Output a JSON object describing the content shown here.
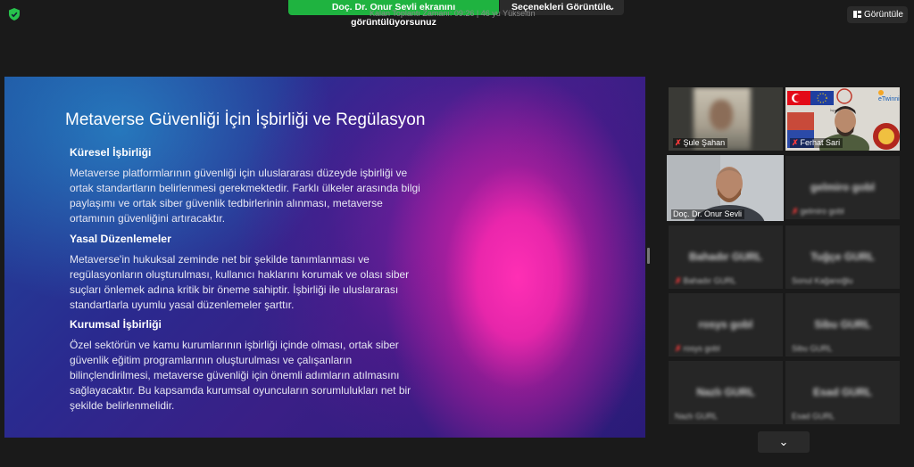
{
  "topbar": {
    "sharing_status": "Doç. Dr. Onur Sevli ekranını görüntülüyorsunuz",
    "view_options_label": "Seçenekleri Görüntüle",
    "meeting_subtitle": "Kalan Toplantı Zamanı: 09:26 | 46 yu Yükseltin",
    "view_button_label": "Görüntüle"
  },
  "slide": {
    "title": "Metaverse Güvenliği İçin İşbirliği ve Regülasyon",
    "sections": [
      {
        "heading": "Küresel İşbirliği",
        "lines": [
          "Metaverse platformlarının güvenliği için uluslararası düzeyde işbirliği ve",
          "ortak standartların belirlenmesi gerekmektedir. Farklı ülkeler arasında bilgi",
          "paylaşımı ve ortak siber güvenlik tedbirlerinin alınması, metaverse",
          "ortamının güvenliğini artıracaktır."
        ]
      },
      {
        "heading": "Yasal Düzenlemeler",
        "lines": [
          "Metaverse'in hukuksal zeminde net bir şekilde tanımlanması ve",
          "regülasyonların oluşturulması, kullanıcı haklarını korumak ve olası siber",
          "suçları önlemek adına kritik bir öneme sahiptir. İşbirliği ile uluslararası",
          "standartlarla uyumlu yasal düzenlemeler şarttır."
        ]
      },
      {
        "heading": "Kurumsal İşbirliği",
        "lines": [
          "Özel sektörün ve kamu kurumlarının işbirliği içinde olması, ortak siber",
          "güvenlik eğitim programlarının oluşturulması ve çalışanların",
          "bilinçlendirilmesi, metaverse güvenliği için önemli adımların atılmasını",
          "sağlayacaktır. Bu kapsamda kurumsal oyuncuların sorumlulukları net bir",
          "şekilde belirlenmelidir."
        ]
      }
    ]
  },
  "participants": [
    {
      "name": "Şule Şahan",
      "muted": true,
      "video": true
    },
    {
      "name": "Ferhat Sari",
      "muted": true,
      "video": true
    },
    {
      "name": "Doç. Dr. Onur Sevli",
      "muted": false,
      "video": true,
      "active": true
    },
    {
      "name": "gelmiro gobl",
      "display": "gelmiro gobl",
      "muted": true,
      "video": false
    },
    {
      "name": "Bahadır GURL",
      "display": "Bahadır GURL",
      "muted": true,
      "video": false
    },
    {
      "name": "Sonul Kağanoğlu",
      "display": "Tuğçe GURL",
      "muted": false,
      "video": false
    },
    {
      "name": "rosys gobl",
      "display": "rosys gobl",
      "muted": true,
      "video": false
    },
    {
      "name": "Sibu GURL",
      "display": "Sibu GURL",
      "muted": false,
      "video": false
    },
    {
      "name": "Nazlı GURL",
      "display": "Nazlı GURL",
      "muted": false,
      "video": false
    },
    {
      "name": "Esad GURL",
      "display": "Esad GURL",
      "muted": false,
      "video": false
    }
  ],
  "colors": {
    "sharing_green": "#1fb340",
    "active_speaker": "#e9e52a",
    "muted_red": "#ff3b3b"
  }
}
